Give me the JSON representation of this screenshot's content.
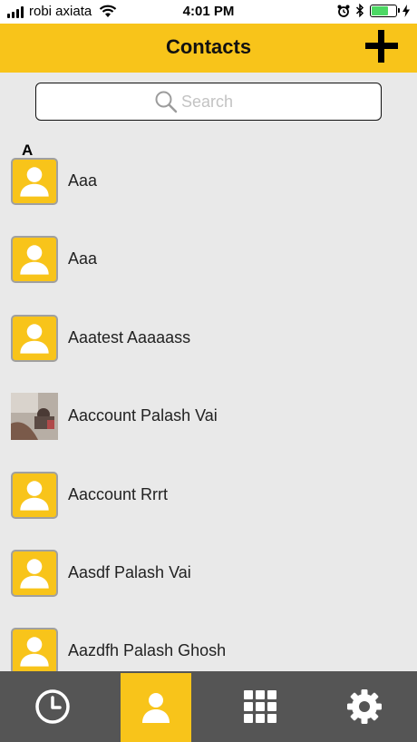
{
  "status_bar": {
    "carrier": "robi axiata",
    "time": "4:01 PM",
    "icons": [
      "signal-icon",
      "wifi-icon",
      "alarm-icon",
      "bluetooth-icon",
      "battery-icon",
      "charging-icon"
    ],
    "battery_level": 0.7,
    "battery_color": "#4cd964"
  },
  "header": {
    "title": "Contacts",
    "add_icon": "plus-icon",
    "background_color": "#f8c41a"
  },
  "search": {
    "placeholder": "Search",
    "value": ""
  },
  "section": {
    "letter": "A"
  },
  "contacts": [
    {
      "name": "Aaa",
      "avatar": "default-avatar-icon"
    },
    {
      "name": "Aaa",
      "avatar": "default-avatar-icon"
    },
    {
      "name": "Aaatest Aaaaass",
      "avatar": "default-avatar-icon"
    },
    {
      "name": "Aaccount  Palash Vai",
      "avatar": "photo"
    },
    {
      "name": "Aaccount Rrrt",
      "avatar": "default-avatar-icon"
    },
    {
      "name": "Aasdf Palash Vai",
      "avatar": "default-avatar-icon"
    },
    {
      "name": "Aazdfh Palash Ghosh",
      "avatar": "default-avatar-icon"
    }
  ],
  "tab_bar": {
    "tabs": [
      {
        "icon": "clock-icon",
        "active": false
      },
      {
        "icon": "contact-icon",
        "active": true
      },
      {
        "icon": "keypad-icon",
        "active": false
      },
      {
        "icon": "gear-icon",
        "active": false
      }
    ],
    "active_color": "#f8c41a",
    "background_color": "#555555"
  }
}
